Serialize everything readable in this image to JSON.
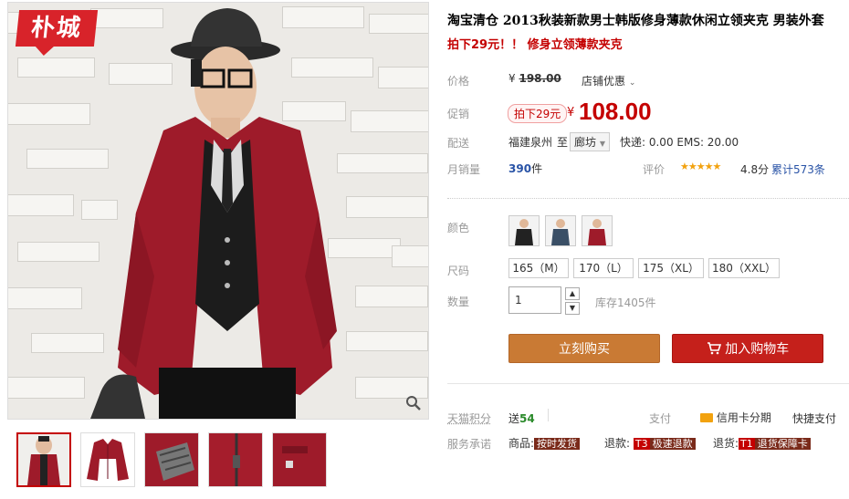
{
  "logo_text": "朴城",
  "zoom_icon": "search-icon",
  "product": {
    "title": "淘宝清仓 2013秋装新款男士韩版修身薄款休闲立领夹克 男装外套",
    "subtitle": "拍下29元！！ 修身立领薄款夹克"
  },
  "price": {
    "label": "价格",
    "currency": "¥",
    "original": "198.00",
    "shop_discount": "店铺优惠"
  },
  "promo": {
    "label": "促销",
    "badge": "拍下29元",
    "currency": "¥",
    "value": "108.00"
  },
  "delivery": {
    "label": "配送",
    "from": "福建泉州",
    "to_label": "至",
    "to": "廊坊",
    "fees": "快递: 0.00 EMS: 20.00"
  },
  "sales": {
    "label": "月销量",
    "count": "390",
    "unit": "件",
    "rating_label": "评价",
    "stars": "★★★★★",
    "score": "4.8分",
    "reviews": "累计573条"
  },
  "color": {
    "label": "颜色"
  },
  "size": {
    "label": "尺码",
    "options": [
      "165（M）",
      "170（L）",
      "175（XL）",
      "180（XXL）"
    ]
  },
  "quantity": {
    "label": "数量",
    "value": "1",
    "stock": "库存1405件"
  },
  "actions": {
    "buy": "立刻购买",
    "cart": "加入购物车"
  },
  "points": {
    "label": "天猫积分",
    "send_prefix": "送",
    "send_value": "54",
    "pay_label": "支付",
    "credit": "信用卡分期",
    "quick_pay": "快捷支付"
  },
  "service": {
    "label": "服务承诺",
    "goods_prefix": "商品:",
    "goods_tag": "按时发货",
    "refund_prefix": "退款:",
    "refund_code": "T3",
    "refund_tag": "极速退款",
    "return_prefix": "退货:",
    "return_code": "T1",
    "return_tag": "退货保障卡"
  },
  "colors": {
    "accent_red": "#c40000",
    "buy_button": "#c97a34",
    "cart_button": "#c5201b",
    "jacket": "#9e1b2a"
  }
}
